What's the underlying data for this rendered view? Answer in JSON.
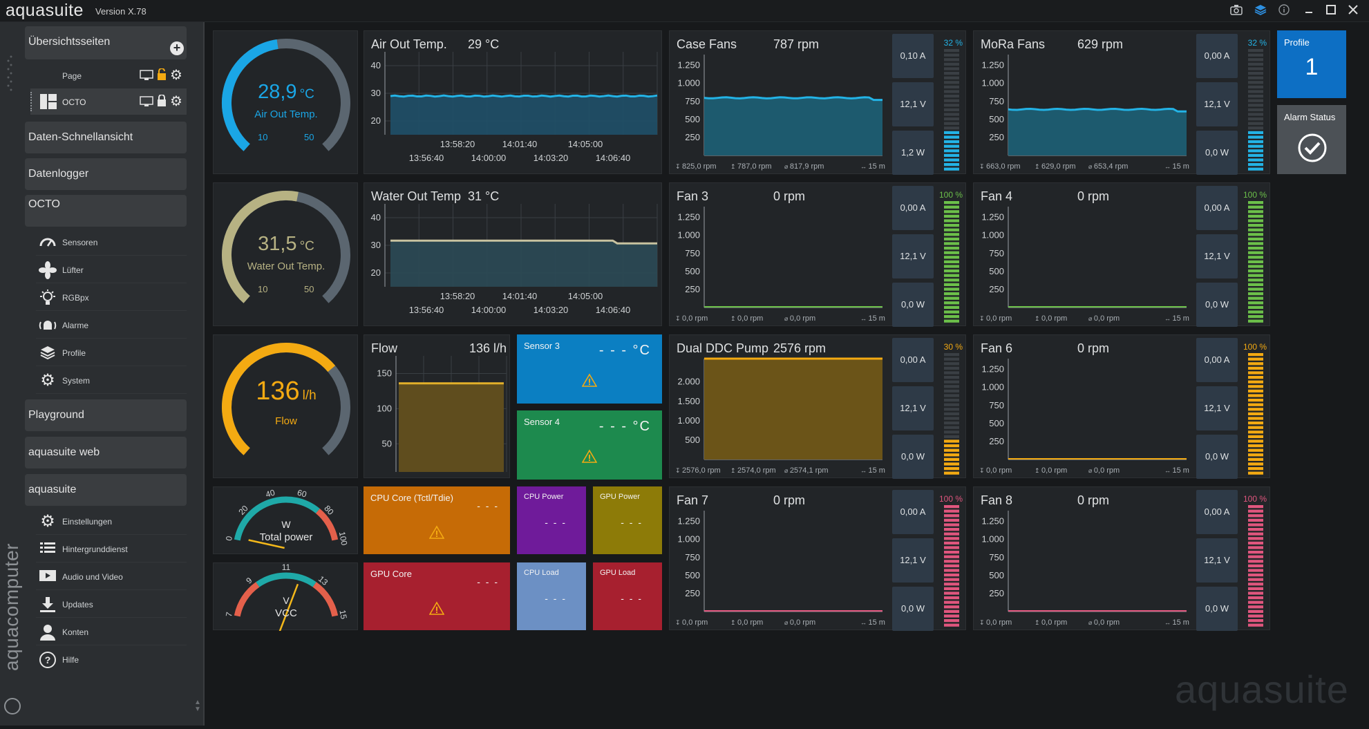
{
  "app": {
    "title": "aquasuite",
    "version": "Version X.78"
  },
  "titlebar_icons": [
    "camera-icon",
    "layers-icon",
    "info-icon",
    "minimize-icon",
    "maximize-icon",
    "close-icon"
  ],
  "sidebar": {
    "overview_label": "Übersichtsseiten",
    "pages": [
      {
        "label": "Page"
      },
      {
        "label": "OCTO"
      }
    ],
    "sections": [
      "Daten-Schnellansicht",
      "Datenlogger",
      "OCTO",
      "Playground",
      "aquasuite web",
      "aquasuite"
    ],
    "octo_items": [
      {
        "label": "Sensoren",
        "icon": "gauge-icon"
      },
      {
        "label": "Lüfter",
        "icon": "fan-icon"
      },
      {
        "label": "RGBpx",
        "icon": "bulb-icon"
      },
      {
        "label": "Alarme",
        "icon": "alarm-icon"
      },
      {
        "label": "Profile",
        "icon": "layers-icon"
      },
      {
        "label": "System",
        "icon": "gear-icon"
      }
    ],
    "suite_items": [
      {
        "label": "Einstellungen",
        "icon": "gear-icon"
      },
      {
        "label": "Hintergrunddienst",
        "icon": "list-icon"
      },
      {
        "label": "Audio und Video",
        "icon": "film-icon"
      },
      {
        "label": "Updates",
        "icon": "download-icon"
      },
      {
        "label": "Konten",
        "icon": "user-icon"
      },
      {
        "label": "Hilfe",
        "icon": "help-icon"
      }
    ],
    "brand": "aquacomputer"
  },
  "gauges": [
    {
      "value": "28,9",
      "unit": "°C",
      "label": "Air Out Temp.",
      "min": "10",
      "max": "50",
      "level": 0.47,
      "color": "#1aa6e6"
    },
    {
      "value": "31,5",
      "unit": "°C",
      "label": "Water Out Temp.",
      "min": "10",
      "max": "50",
      "level": 0.54,
      "color": "#b7b283"
    },
    {
      "value": "136",
      "unit": "l/h",
      "label": "Flow",
      "min": "",
      "max": "",
      "level": 0.68,
      "color": "#f4aa12"
    }
  ],
  "dials": [
    {
      "unit": "W",
      "label": "Total power",
      "ticks": [
        "0",
        "20",
        "40",
        "60",
        "80",
        "100"
      ],
      "needle": 0.02
    },
    {
      "unit": "V",
      "label": "VCC",
      "ticks": [
        "7",
        "9",
        "11",
        "13",
        "15"
      ],
      "needle": 0.6
    }
  ],
  "temp_charts": [
    {
      "title": "Air Out Temp.",
      "value": "29 °C",
      "yticks": [
        "40",
        "30",
        "20"
      ],
      "xticks_top": [
        "13:58:20",
        "14:01:40",
        "14:05:00"
      ],
      "xticks_bottom": [
        "13:56:40",
        "14:00:00",
        "14:03:20",
        "14:06:40"
      ],
      "color": "#23b3e6"
    },
    {
      "title": "Water Out Temp",
      "value": "31 °C",
      "yticks": [
        "40",
        "30",
        "20"
      ],
      "xticks_top": [
        "13:58:20",
        "14:01:40",
        "14:05:00"
      ],
      "xticks_bottom": [
        "13:56:40",
        "14:00:00",
        "14:03:20",
        "14:06:40"
      ],
      "color": "#c8c3a0"
    }
  ],
  "flow_chart": {
    "title": "Flow",
    "value": "136 l/h",
    "yticks": [
      "150",
      "100",
      "50"
    ],
    "color": "#e2b02a"
  },
  "sensor_tiles": [
    {
      "title": "Sensor 3",
      "value": "- - - °C",
      "color": "#0b7fc2"
    },
    {
      "title": "Sensor 4",
      "value": "- - - °C",
      "color": "#1d8a4e"
    }
  ],
  "hw_tiles": [
    {
      "title": "CPU Core (Tctl/Tdie)",
      "value": "- - -",
      "color": "#c66b06",
      "warn": true
    },
    {
      "title": "CPU Power",
      "value": "- - -",
      "color": "#6f1b9a",
      "warn": false
    },
    {
      "title": "GPU Power",
      "value": "- - -",
      "color": "#8d7b08",
      "warn": false
    },
    {
      "title": "GPU Core",
      "value": "- - -",
      "color": "#a7202f",
      "warn": true
    },
    {
      "title": "CPU Load",
      "value": "- - -",
      "color": "#6c90c4",
      "warn": false
    },
    {
      "title": "GPU Load",
      "value": "- - -",
      "color": "#a7202f",
      "warn": false
    }
  ],
  "fans": [
    {
      "title": "Case Fans",
      "rpm": "787 rpm",
      "amps": "0,10 A",
      "volts": "12,1 V",
      "watts": "1,2 W",
      "pct": "32 %",
      "level": 0.32,
      "color": "#23b3e6",
      "yticks": [
        "1.250",
        "1.000",
        "750",
        "500",
        "250"
      ],
      "footer": [
        "825,0 rpm",
        "787,0 rpm",
        "817,9 rpm",
        "15 m"
      ],
      "fill": 0.55
    },
    {
      "title": "MoRa Fans",
      "rpm": "629 rpm",
      "amps": "0,00 A",
      "volts": "12,1 V",
      "watts": "0,0 W",
      "pct": "32 %",
      "level": 0.32,
      "color": "#23b3e6",
      "yticks": [
        "1.250",
        "1.000",
        "750",
        "500",
        "250"
      ],
      "footer": [
        "663,0 rpm",
        "629,0 rpm",
        "653,4 rpm",
        "15 m"
      ],
      "fill": 0.44
    },
    {
      "title": "Fan 3",
      "rpm": "0 rpm",
      "amps": "0,00 A",
      "volts": "12,1 V",
      "watts": "0,0 W",
      "pct": "100 %",
      "level": 1,
      "color": "#6cc04a",
      "yticks": [
        "1.250",
        "1.000",
        "750",
        "500",
        "250"
      ],
      "footer": [
        "0,0 rpm",
        "0,0 rpm",
        "0,0 rpm",
        "15 m"
      ],
      "fill": 0
    },
    {
      "title": "Fan 4",
      "rpm": "0 rpm",
      "amps": "0,00 A",
      "volts": "12,1 V",
      "watts": "0,0 W",
      "pct": "100 %",
      "level": 1,
      "color": "#6cc04a",
      "yticks": [
        "1.250",
        "1.000",
        "750",
        "500",
        "250"
      ],
      "footer": [
        "0,0 rpm",
        "0,0 rpm",
        "0,0 rpm",
        "15 m"
      ],
      "fill": 0
    },
    {
      "title": "Dual DDC Pump",
      "rpm": "2576 rpm",
      "amps": "0,00 A",
      "volts": "12,1 V",
      "watts": "0,0 W",
      "pct": "30 %",
      "level": 0.3,
      "color": "#f4aa12",
      "yticks": [
        "2.000",
        "1.500",
        "1.000",
        "500"
      ],
      "footer": [
        "2576,0 rpm",
        "2574,0 rpm",
        "2574,1 rpm",
        "15 m"
      ],
      "fill": 1
    },
    {
      "title": "Fan 6",
      "rpm": "0 rpm",
      "amps": "0,00 A",
      "volts": "12,1 V",
      "watts": "0,0 W",
      "pct": "100 %",
      "level": 1,
      "color": "#f4aa12",
      "yticks": [
        "1.250",
        "1.000",
        "750",
        "500",
        "250"
      ],
      "footer": [
        "0,0 rpm",
        "0,0 rpm",
        "0,0 rpm",
        "15 m"
      ],
      "fill": 0
    },
    {
      "title": "Fan 7",
      "rpm": "0 rpm",
      "amps": "0,00 A",
      "volts": "12,1 V",
      "watts": "0,0 W",
      "pct": "100 %",
      "level": 1,
      "color": "#e0567e",
      "yticks": [
        "1.250",
        "1.000",
        "750",
        "500",
        "250"
      ],
      "footer": [
        "0,0 rpm",
        "0,0 rpm",
        "0,0 rpm",
        "15 m"
      ],
      "fill": 0
    },
    {
      "title": "Fan 8",
      "rpm": "0 rpm",
      "amps": "0,00 A",
      "volts": "12,1 V",
      "watts": "0,0 W",
      "pct": "100 %",
      "level": 1,
      "color": "#e0567e",
      "yticks": [
        "1.250",
        "1.000",
        "750",
        "500",
        "250"
      ],
      "footer": [
        "0,0 rpm",
        "0,0 rpm",
        "0,0 rpm",
        "15 m"
      ],
      "fill": 0
    }
  ],
  "profile": {
    "label": "Profile",
    "value": "1",
    "color": "#0d6fc4"
  },
  "alarm": {
    "label": "Alarm Status"
  },
  "watermark": "aquasuite"
}
